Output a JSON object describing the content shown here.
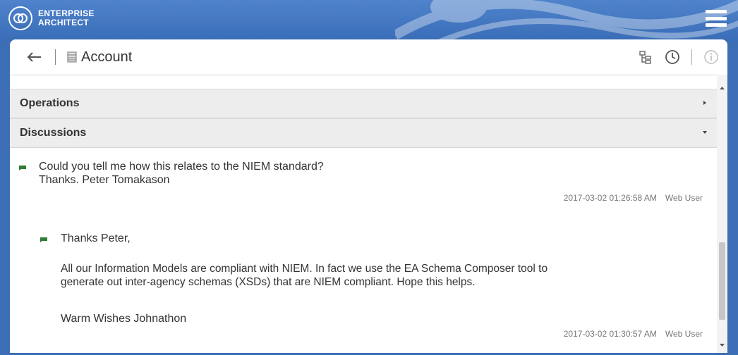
{
  "brand": {
    "line1": "ENTERPRISE",
    "line2": "ARCHITECT"
  },
  "header": {
    "title": "Account"
  },
  "sections": [
    {
      "label": "Operations",
      "state": "collapsed"
    },
    {
      "label": "Discussions",
      "state": "expanded"
    }
  ],
  "discussions": [
    {
      "lines": [
        "Could you tell me how this relates to the NIEM standard?",
        "Thanks. Peter Tomakason"
      ],
      "timestamp": "2017-03-02 01:26:58 AM",
      "user": "Web User"
    },
    {
      "greeting": "Thanks Peter,",
      "body1": "All our Information Models are compliant with NIEM. In fact we use the EA Schema Composer tool to",
      "body2": "generate out inter-agency schemas (XSDs) that are NIEM compliant. Hope this helps.",
      "signoff": "Warm Wishes Johnathon",
      "timestamp": "2017-03-02 01:30:57 AM",
      "user": "Web User"
    }
  ],
  "colors": {
    "accent": "#3d6fb6",
    "bubble": "#2e7d32"
  },
  "icons": [
    "logo-icon",
    "hamburger-menu-icon",
    "back-arrow-icon",
    "element-icon",
    "hierarchy-icon",
    "clock-icon",
    "info-icon",
    "chevron-right-icon",
    "chevron-down-icon",
    "comment-bubble-icon"
  ]
}
